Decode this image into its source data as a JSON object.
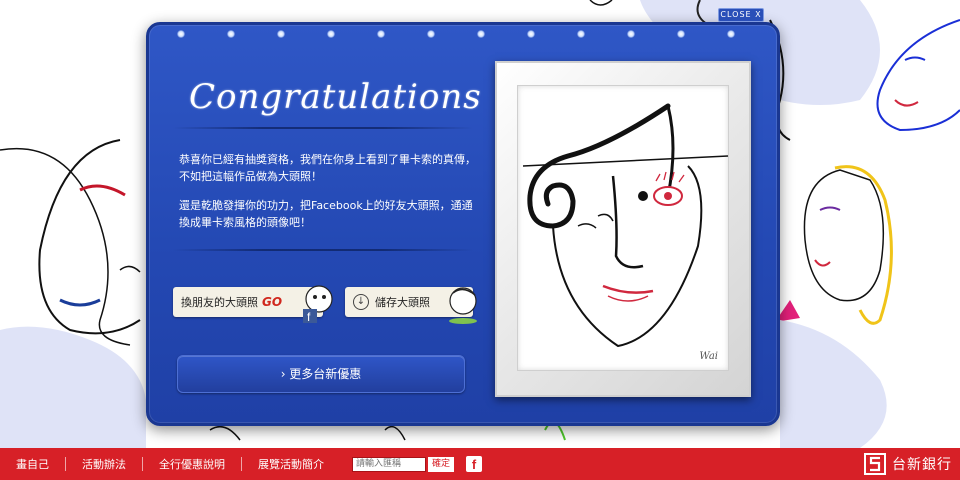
{
  "modal": {
    "close_label": "CLOSE X",
    "title": "Congratulations",
    "paragraph1": "恭喜你已經有抽獎資格，我們在你身上看到了畢卡索的真傳，不如把這幅作品做為大頭照！",
    "paragraph2": "還是乾脆發揮你的功力，把Facebook上的好友大頭照，通通換成畢卡索風格的頭像吧！",
    "change_friend_label": "換朋友的大頭照",
    "change_friend_go": "GO",
    "save_label": "儲存大頭照",
    "more_label": "›  更多台新優惠",
    "artwork_signature": "Wai"
  },
  "footer": {
    "links": [
      "畫自己",
      "活動辦法",
      "全行優惠說明",
      "展覽活動簡介"
    ],
    "search_placeholder": "請輸入匯稱",
    "search_button": "確定",
    "fb_icon_glyph": "f",
    "bank_name": "台新銀行"
  },
  "colors": {
    "modal_blue": "#2449b4",
    "footer_red": "#d72027"
  }
}
